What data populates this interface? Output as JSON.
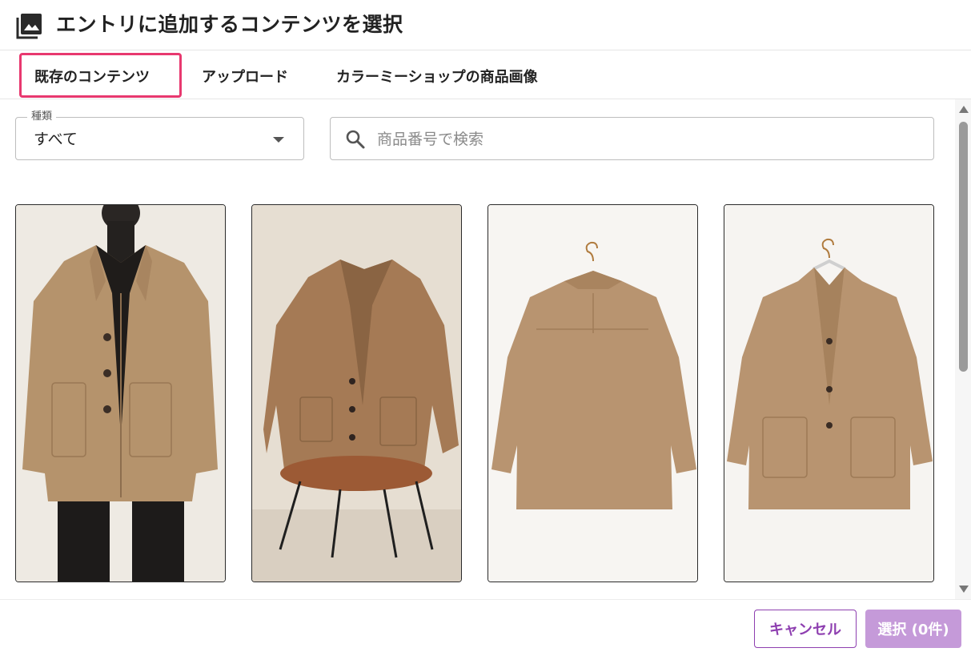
{
  "dialog": {
    "title": "エントリに追加するコンテンツを選択",
    "header_icon": "image-gallery-icon"
  },
  "tabs": [
    {
      "label": "既存のコンテンツ",
      "active": true
    },
    {
      "label": "アップロード",
      "active": false
    },
    {
      "label": "カラーミーショップの商品画像",
      "active": false
    }
  ],
  "filter": {
    "legend": "種類",
    "selected": "すべて"
  },
  "search": {
    "placeholder": "商品番号で検索",
    "value": ""
  },
  "grid": {
    "items": [
      {
        "image": "model-wearing-camel-coat"
      },
      {
        "image": "camel-jacket-on-chair"
      },
      {
        "image": "camel-coat-back-on-hanger"
      },
      {
        "image": "camel-coat-front-on-hanger"
      }
    ]
  },
  "footer": {
    "cancel_label": "キャンセル",
    "select_label": "選択 (0件)"
  },
  "colors": {
    "accent": "#8e3fb0",
    "accent_disabled": "#c59ad9",
    "tab_highlight": "#e8386f",
    "coat": "#b08e68"
  }
}
